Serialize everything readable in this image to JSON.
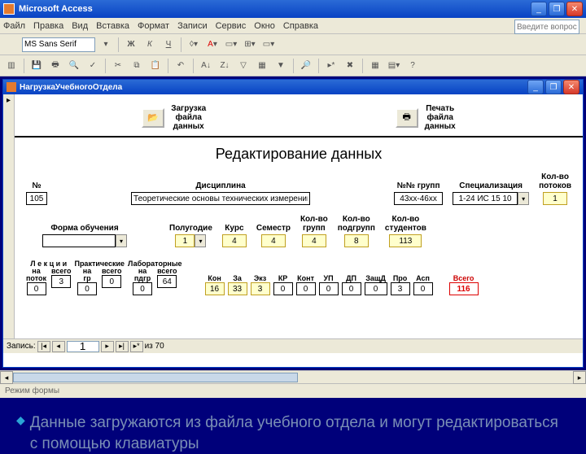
{
  "app": {
    "title": "Microsoft Access",
    "search_placeholder": "Введите вопрос"
  },
  "menu": [
    "Файл",
    "Правка",
    "Вид",
    "Вставка",
    "Формат",
    "Записи",
    "Сервис",
    "Окно",
    "Справка"
  ],
  "font_name": "MS Sans Serif",
  "subform": {
    "title": "НагрузкаУчебногоОтдела"
  },
  "buttons": {
    "load": "Загрузка\nфайла\nданных",
    "print": "Печать\nфайла\nданных"
  },
  "section_title": "Редактирование данных",
  "headers": {
    "no": "№",
    "discipline": "Дисциплина",
    "groups": "№№ групп",
    "spec": "Специализация",
    "streams": "Кол-во\nпотоков",
    "form": "Форма обучения",
    "half": "Полугодие",
    "course": "Курс",
    "sem": "Семестр",
    "ngrp": "Кол-во\nгрупп",
    "npodgr": "Кол-во\nподгрупп",
    "nstud": "Кол-во\nстудентов",
    "lectures": "Л е к ц и и",
    "practical": "Практические",
    "labs": "Лабораторные",
    "per_stream": "на\nпоток",
    "per_group": "на\nгр",
    "per_subgroup": "на\nпдгр",
    "total_col": "всего",
    "kon": "Кон",
    "za": "За",
    "ekz": "Экз",
    "kr": "КР",
    "konr": "Конт",
    "up": "УП",
    "dp": "ДП",
    "zashd": "ЗащД",
    "pro": "Про",
    "asp": "Асп",
    "total": "Всего"
  },
  "values": {
    "no": "105",
    "discipline": "Теоретические основы технических измерений и моделирование",
    "groups": "43хх-46хх",
    "spec": "1-24 ИС 15 10",
    "streams": "1",
    "form": "",
    "half": "1",
    "course": "4",
    "sem": "4",
    "ngrp": "4",
    "npodgr": "8",
    "nstud": "113",
    "lec_stream": "0",
    "lec_total": "3",
    "pr_grp": "0",
    "pr_total": "0",
    "lab_pdgr": "0",
    "lab_total": "64",
    "kon": "16",
    "za": "33",
    "ekz": "3",
    "kr": "0",
    "konr": "0",
    "up": "0",
    "dp": "0",
    "zashd": "0",
    "pro": "3",
    "asp": "0",
    "total": "116"
  },
  "nav": {
    "label": "Запись:",
    "current": "1",
    "of": "из 70"
  },
  "status": "Режим формы",
  "slide_text": "Данные загружаются из файла учебного отдела и могут редактироваться с помощью клавиатуры"
}
